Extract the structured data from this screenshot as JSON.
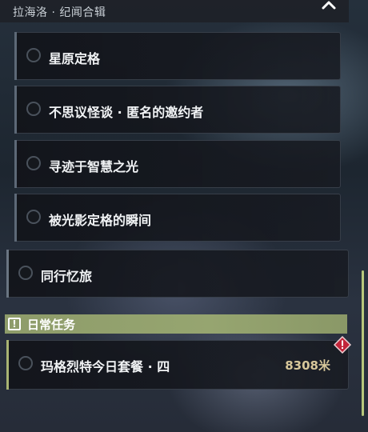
{
  "header": {
    "title": "拉海洛 · 纪闻合辑"
  },
  "quests": [
    {
      "label": "星原定格"
    },
    {
      "label": "不思议怪谈 · 匿名的邀约者"
    },
    {
      "label": "寻迹于智慧之光"
    },
    {
      "label": "被光影定格的瞬间"
    }
  ],
  "main_quest": {
    "label": "同行忆旅"
  },
  "daily": {
    "section_label": "日常任务",
    "section_icon": "exclamation-icon",
    "quest_label": "玛格烈特今日套餐 · 四",
    "distance": "8308米",
    "badge_icon": "warning-diamond-icon"
  },
  "colors": {
    "daily_accent": "#96a570",
    "distance_text": "#d7c79a",
    "badge_red": "#c2253a"
  }
}
